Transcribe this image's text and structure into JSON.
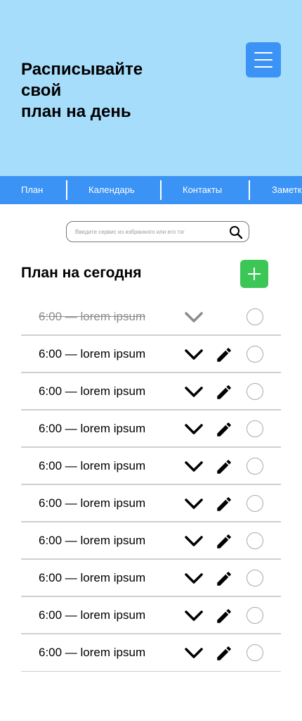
{
  "hero": {
    "title": "Расписывайте\nсвой\nплан на день"
  },
  "nav": {
    "tabs": [
      {
        "label": "План"
      },
      {
        "label": "Календарь"
      },
      {
        "label": "Контакты"
      },
      {
        "label": "Заметки"
      }
    ]
  },
  "search": {
    "placeholder": "Введите сервис из избранного или его тэг"
  },
  "plan": {
    "title": "План на сегодня",
    "tasks": [
      {
        "label": "6:00 — lorem ipsum",
        "done": true
      },
      {
        "label": "6:00 — lorem ipsum",
        "done": false
      },
      {
        "label": "6:00 — lorem ipsum",
        "done": false
      },
      {
        "label": "6:00 — lorem ipsum",
        "done": false
      },
      {
        "label": "6:00 — lorem ipsum",
        "done": false
      },
      {
        "label": "6:00 — lorem ipsum",
        "done": false
      },
      {
        "label": "6:00 — lorem ipsum",
        "done": false
      },
      {
        "label": "6:00 — lorem ipsum",
        "done": false
      },
      {
        "label": "6:00 — lorem ipsum",
        "done": false
      },
      {
        "label": "6:00 — lorem ipsum",
        "done": false
      }
    ]
  },
  "colors": {
    "hero_bg": "#a6ddfb",
    "accent_blue": "#3b93f5",
    "add_green": "#3cc655",
    "divider": "#cfcfcf"
  },
  "icons": {
    "menu": "hamburger-icon",
    "search": "search-icon",
    "add": "plus-icon",
    "expand": "chevron-down-icon",
    "edit": "pencil-icon",
    "complete": "circle-checkbox-icon"
  }
}
